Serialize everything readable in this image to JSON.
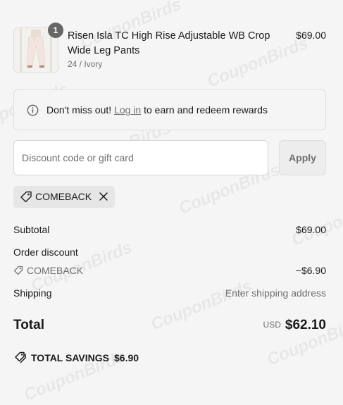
{
  "watermark": "CouponBirds",
  "line_item": {
    "quantity": "1",
    "name": "Risen Isla TC High Rise Adjustable WB Crop Wide Leg Pants",
    "variant": "24 / Ivory",
    "price": "$69.00",
    "image_icon": "pants-product-image"
  },
  "rewards": {
    "icon": "info-icon",
    "prefix": "Don't miss out!",
    "link": "Log in",
    "suffix": "to earn and redeem rewards"
  },
  "discount": {
    "placeholder": "Discount code or gift card",
    "value": "",
    "apply_label": "Apply"
  },
  "applied_code": {
    "code": "COMEBACK",
    "tag_icon": "tag-icon",
    "remove_icon": "close-icon"
  },
  "summary": {
    "subtotal_label": "Subtotal",
    "subtotal_value": "$69.00",
    "order_discount_label": "Order discount",
    "discount_code": "COMEBACK",
    "discount_value": "−$6.90",
    "shipping_label": "Shipping",
    "shipping_value": "Enter shipping address",
    "total_label": "Total",
    "currency": "USD",
    "total_value": "$62.10",
    "savings_label": "TOTAL SAVINGS",
    "savings_value": "$6.90"
  }
}
